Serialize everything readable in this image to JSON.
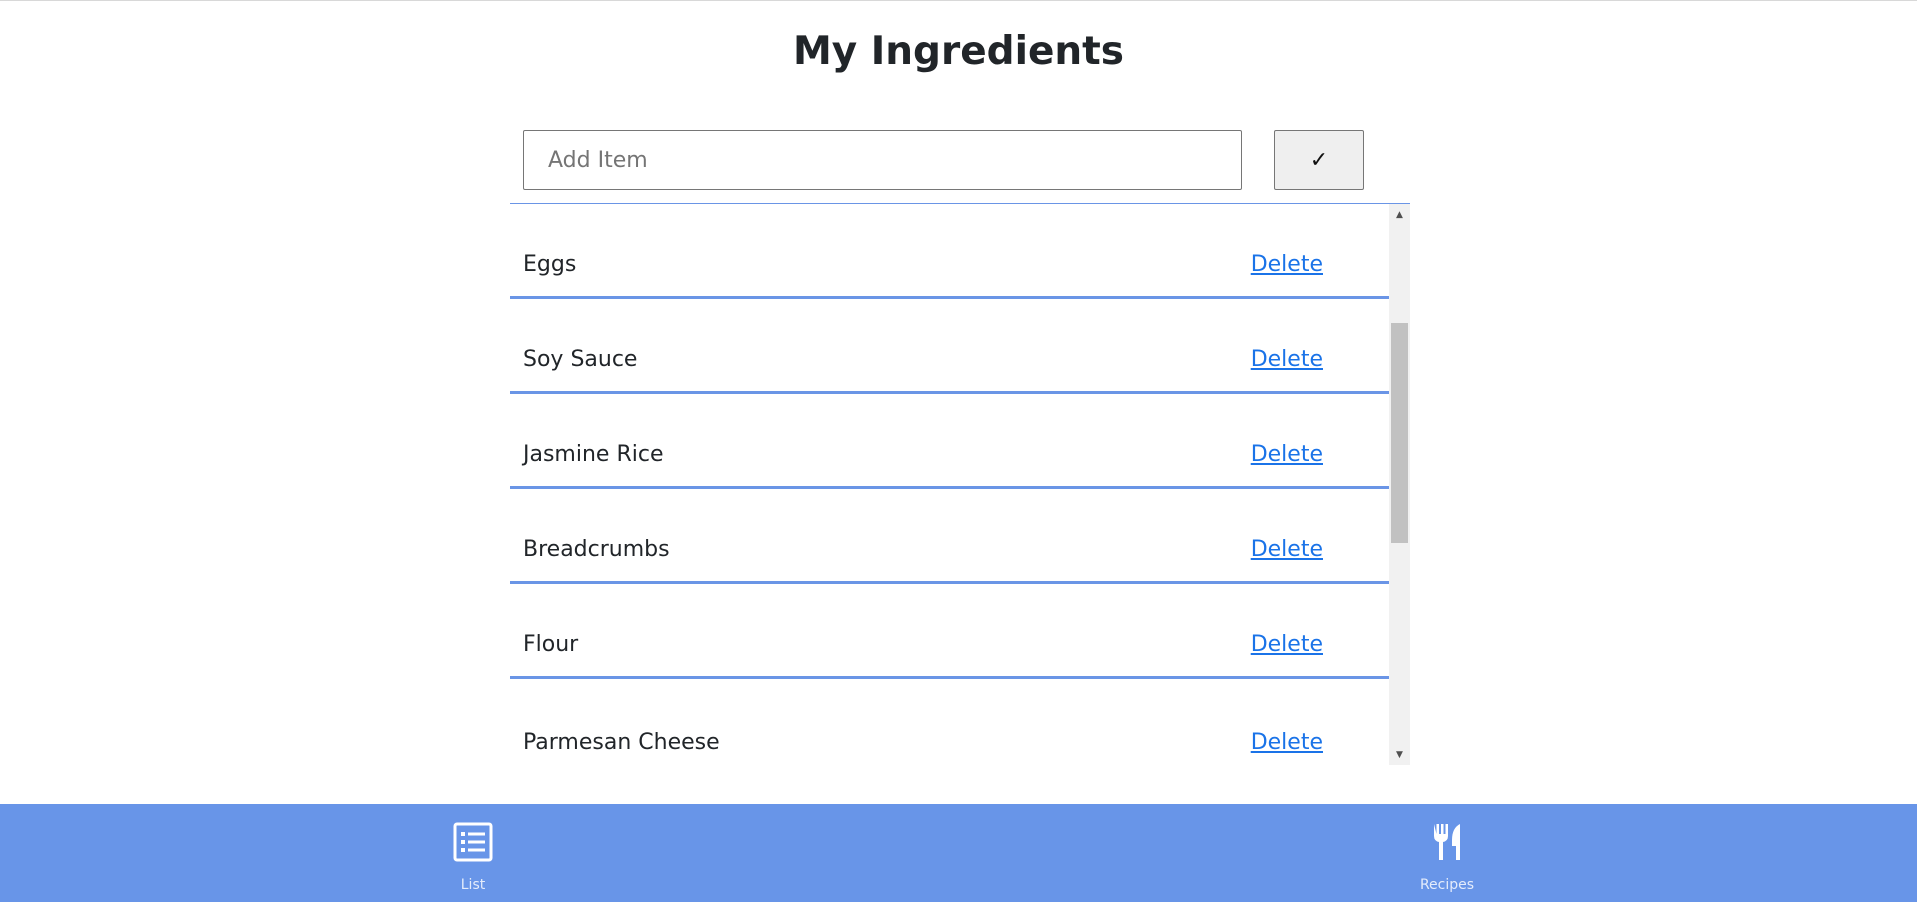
{
  "header": {
    "title": "My Ingredients"
  },
  "add_form": {
    "placeholder": "Add Item",
    "value": "",
    "submit_label": "✓"
  },
  "ingredients": {
    "delete_label": "Delete",
    "items": [
      {
        "name": "Eggs"
      },
      {
        "name": "Soy Sauce"
      },
      {
        "name": "Jasmine Rice"
      },
      {
        "name": "Breadcrumbs"
      },
      {
        "name": "Flour"
      },
      {
        "name": "Parmesan Cheese"
      }
    ]
  },
  "bottom_nav": {
    "tabs": [
      {
        "label": "List",
        "icon": "list-icon"
      },
      {
        "label": "Recipes",
        "icon": "fork-knife-icon"
      }
    ]
  },
  "colors": {
    "accent": "#6895e8",
    "divider": "#6a95e6",
    "link": "#1a73e8"
  }
}
